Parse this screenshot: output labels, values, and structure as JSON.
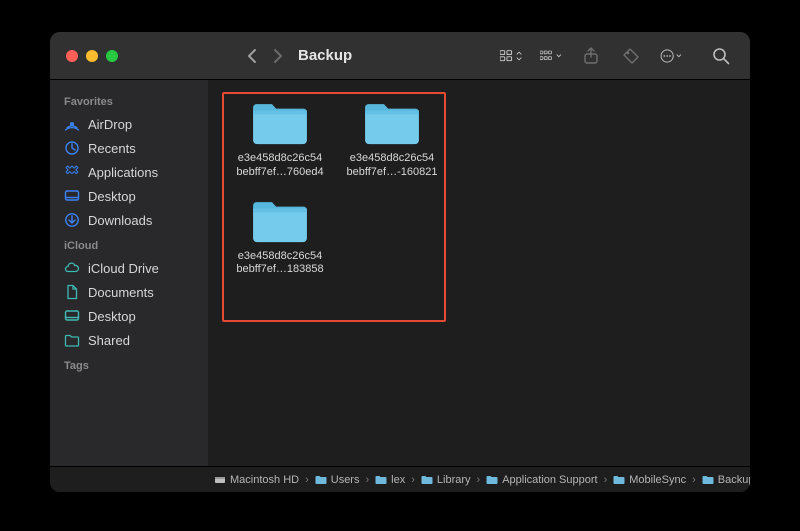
{
  "window": {
    "title": "Backup"
  },
  "sidebar": {
    "sections": [
      {
        "label": "Favorites",
        "items": [
          {
            "icon": "airdrop",
            "label": "AirDrop"
          },
          {
            "icon": "recents",
            "label": "Recents"
          },
          {
            "icon": "apps",
            "label": "Applications"
          },
          {
            "icon": "desktop",
            "label": "Desktop"
          },
          {
            "icon": "downloads",
            "label": "Downloads"
          }
        ]
      },
      {
        "label": "iCloud",
        "items": [
          {
            "icon": "icloud",
            "label": "iCloud Drive"
          },
          {
            "icon": "doc",
            "label": "Documents"
          },
          {
            "icon": "desktop",
            "label": "Desktop"
          },
          {
            "icon": "shared",
            "label": "Shared"
          }
        ]
      },
      {
        "label": "Tags",
        "items": []
      }
    ]
  },
  "content": {
    "folders": [
      {
        "line1": "e3e458d8c26c54",
        "line2": "bebff7ef…760ed4"
      },
      {
        "line1": "e3e458d8c26c54",
        "line2": "bebff7ef…-160821"
      },
      {
        "line1": "e3e458d8c26c54",
        "line2": "bebff7ef…183858"
      }
    ]
  },
  "pathbar": {
    "segments": [
      {
        "icon": "disk",
        "label": "Macintosh HD"
      },
      {
        "icon": "folder",
        "label": "Users"
      },
      {
        "icon": "folder",
        "label": "lex"
      },
      {
        "icon": "folder",
        "label": "Library"
      },
      {
        "icon": "folder",
        "label": "Application Support"
      },
      {
        "icon": "folder",
        "label": "MobileSync"
      },
      {
        "icon": "folder",
        "label": "Backup"
      }
    ]
  },
  "colors": {
    "accent": "#3a82f7",
    "folder": "#6fc6e8",
    "highlight": "#e64a33"
  }
}
